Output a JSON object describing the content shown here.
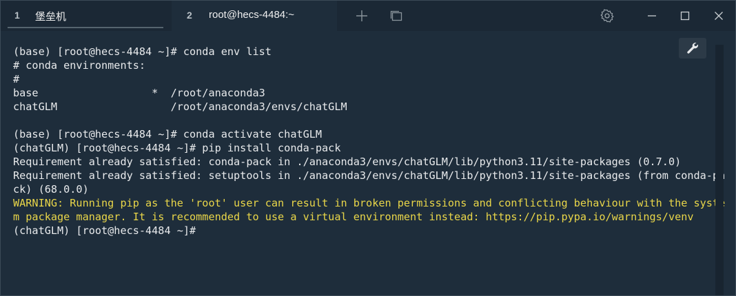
{
  "tabs": [
    {
      "number": "1",
      "label": "堡垒机"
    },
    {
      "number": "2",
      "label": "root@hecs-4484:~"
    }
  ],
  "titlebar_icons": [
    "plus-icon",
    "tabs-icon",
    "gear-icon",
    "minimize-icon",
    "maximize-icon",
    "close-icon"
  ],
  "terminal": {
    "lines": [
      "(base) [root@hecs-4484 ~]# conda env list",
      "# conda environments:",
      "#",
      "base                  *  /root/anaconda3",
      "chatGLM                  /root/anaconda3/envs/chatGLM",
      "",
      "(base) [root@hecs-4484 ~]# conda activate chatGLM",
      "(chatGLM) [root@hecs-4484 ~]# pip install conda-pack",
      "Requirement already satisfied: conda-pack in ./anaconda3/envs/chatGLM/lib/python3.11/site-packages (0.7.0)",
      "Requirement already satisfied: setuptools in ./anaconda3/envs/chatGLM/lib/python3.11/site-packages (from conda-pa",
      "ck) (68.0.0)",
      "WARNING: Running pip as the 'root' user can result in broken permissions and conflicting behaviour with the syste",
      "m package manager. It is recommended to use a virtual environment instead: https://pip.pypa.io/warnings/venv",
      "(chatGLM) [root@hecs-4484 ~]#"
    ],
    "warning_color": "#e9d649",
    "text_color": "#e8eaec",
    "background": "#1e2d3b"
  },
  "tool_icon": "wrench-icon"
}
